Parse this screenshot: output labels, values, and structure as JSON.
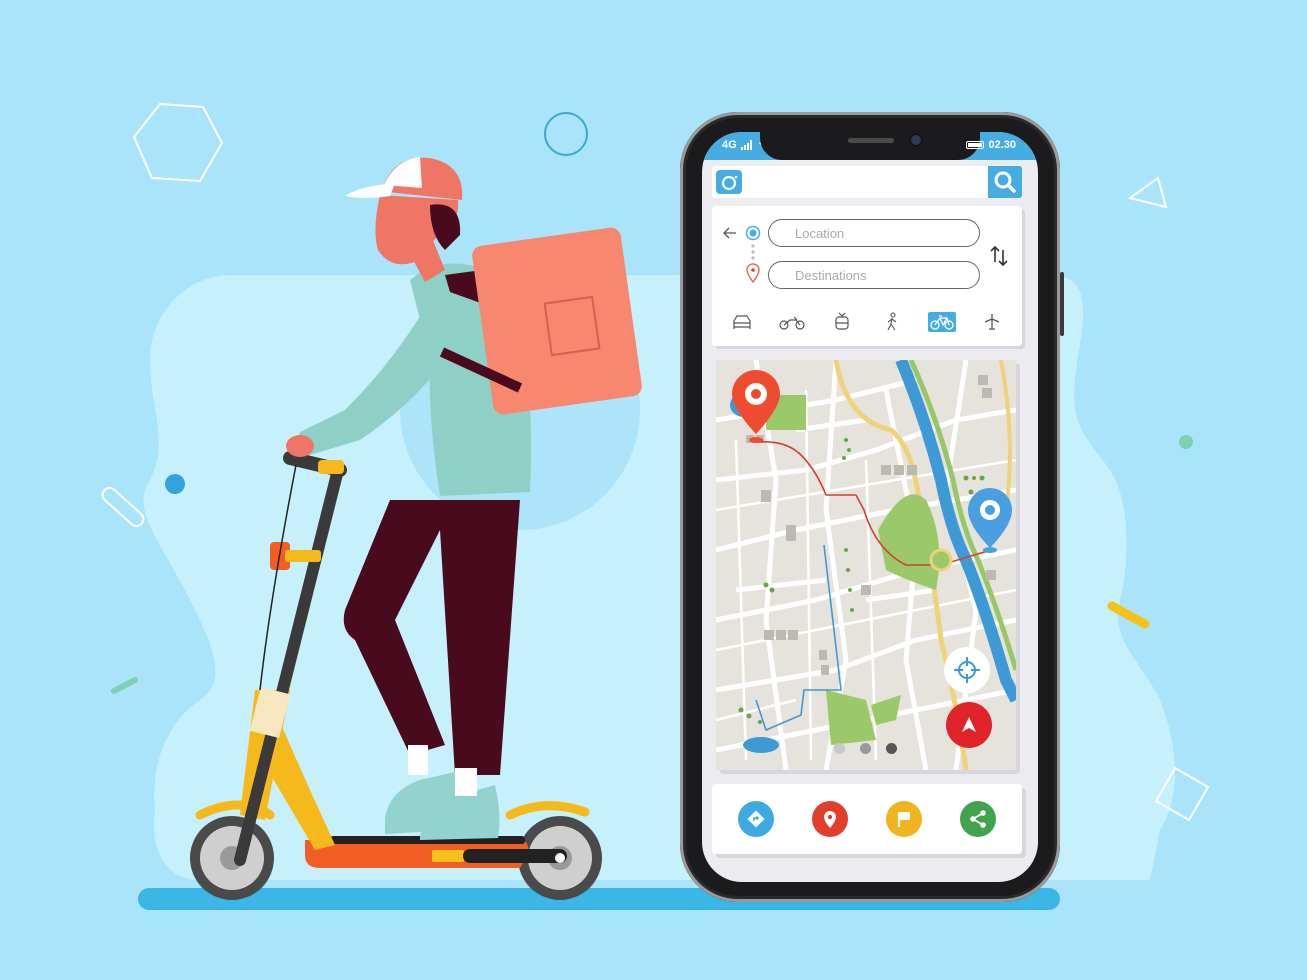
{
  "status_bar": {
    "network": "4G",
    "time": "02.30",
    "icons": [
      "signal-bars-icon",
      "wifi-icon",
      "battery-icon"
    ],
    "color": "#45ade2"
  },
  "search_bar": {
    "left_icon": "camera-icon",
    "right_icon": "search-icon",
    "value": ""
  },
  "route": {
    "back_icon": "back-arrow-icon",
    "origin_placeholder": "Location",
    "destination_placeholder": "Destinations",
    "swap_icon": "swap-vertical-icon",
    "modes": [
      {
        "name": "car",
        "icon": "car-icon",
        "active": false
      },
      {
        "name": "motorcycle",
        "icon": "motorcycle-icon",
        "active": false
      },
      {
        "name": "train",
        "icon": "train-icon",
        "active": false
      },
      {
        "name": "walk",
        "icon": "walk-icon",
        "active": false
      },
      {
        "name": "bicycle",
        "icon": "bicycle-icon",
        "active": true
      },
      {
        "name": "flight",
        "icon": "airplane-icon",
        "active": false
      }
    ]
  },
  "map": {
    "origin_pin_color": "#ef4b2f",
    "destination_pin_color": "#4a9fe0",
    "route_color": "#d1402c",
    "alt_route_color": "#3d9ad6",
    "locate_icon": "crosshair-icon",
    "navigate_icon": "navigation-arrow-icon",
    "page_dots": 3,
    "active_dot": 3
  },
  "actions": [
    {
      "name": "directions",
      "icon": "directions-icon",
      "color": "#3eaae2"
    },
    {
      "name": "location",
      "icon": "location-pin-icon",
      "color": "#e23e2c"
    },
    {
      "name": "flag",
      "icon": "flag-icon",
      "color": "#f0b420"
    },
    {
      "name": "share",
      "icon": "share-icon",
      "color": "#3fa44d"
    }
  ],
  "colors": {
    "background": "#a9e4fb",
    "blob": "#c7f0fd",
    "ground": "#3ab7e6",
    "accent": "#45ade2"
  }
}
